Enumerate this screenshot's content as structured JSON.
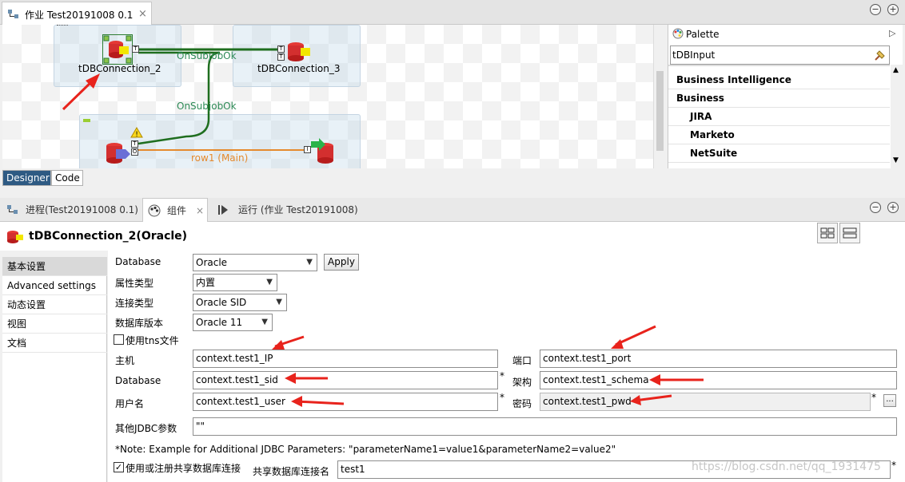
{
  "job_tab": {
    "label": "作业 Test20191008 0.1",
    "close": "×"
  },
  "window_controls": {
    "minimize": "−",
    "maximize": "+"
  },
  "designer": {
    "components": {
      "db_connection_2": "tDBConnection_2",
      "db_connection_3": "tDBConnection_3"
    },
    "links": {
      "subjob_ok_1": "OnSubjobOk",
      "subjob_ok_2": "OnSubjobOk",
      "row1": "row1 (Main)"
    },
    "tabs": {
      "designer": "Designer",
      "code": "Code"
    }
  },
  "palette": {
    "title": "Palette",
    "search_value": "tDBInput",
    "items": [
      "Business Intelligence",
      "Business",
      "JIRA",
      "Marketo",
      "NetSuite"
    ]
  },
  "bottom_tabs": {
    "process": "进程(Test20191008 0.1)",
    "components": "组件",
    "run": "运行 (作业 Test20191008)"
  },
  "component_title": "tDBConnection_2(Oracle)",
  "left_nav": [
    "基本设置",
    "Advanced settings",
    "动态设置",
    "视图",
    "文档"
  ],
  "form": {
    "database_label": "Database",
    "database_value": "Oracle",
    "apply_label": "Apply",
    "property_type_label": "属性类型",
    "property_type_value": "内置",
    "connection_type_label": "连接类型",
    "connection_type_value": "Oracle SID",
    "db_version_label": "数据库版本",
    "db_version_value": "Oracle 11",
    "use_tns_label": "使用tns文件",
    "host_label": "主机",
    "host_value": "context.test1_IP",
    "port_label": "端口",
    "port_value": "context.test1_port",
    "db_label": "Database",
    "db_value": "context.test1_sid",
    "schema_label": "架构",
    "schema_value": "context.test1_schema",
    "user_label": "用户名",
    "user_value": "context.test1_user",
    "password_label": "密码",
    "password_value": "context.test1_pwd",
    "more_button": "...",
    "jdbc_label": "其他JDBC参数",
    "jdbc_value": "\"\"",
    "note": "*Note: Example for Additional JDBC Parameters: \"parameterName1=value1&parameterName2=value2\"",
    "shared_conn_label": "使用或注册共享数据库连接",
    "shared_name_label": "共享数据库连接名",
    "shared_name_value": "test1",
    "required_mark": "*"
  },
  "watermark": "https://blog.csdn.net/qq_1931475",
  "colors": {
    "arrow": "#e8231c",
    "link_green": "#1f6e1f",
    "row_link": "#e58a2e",
    "designer_tab": "#2e5a83"
  }
}
